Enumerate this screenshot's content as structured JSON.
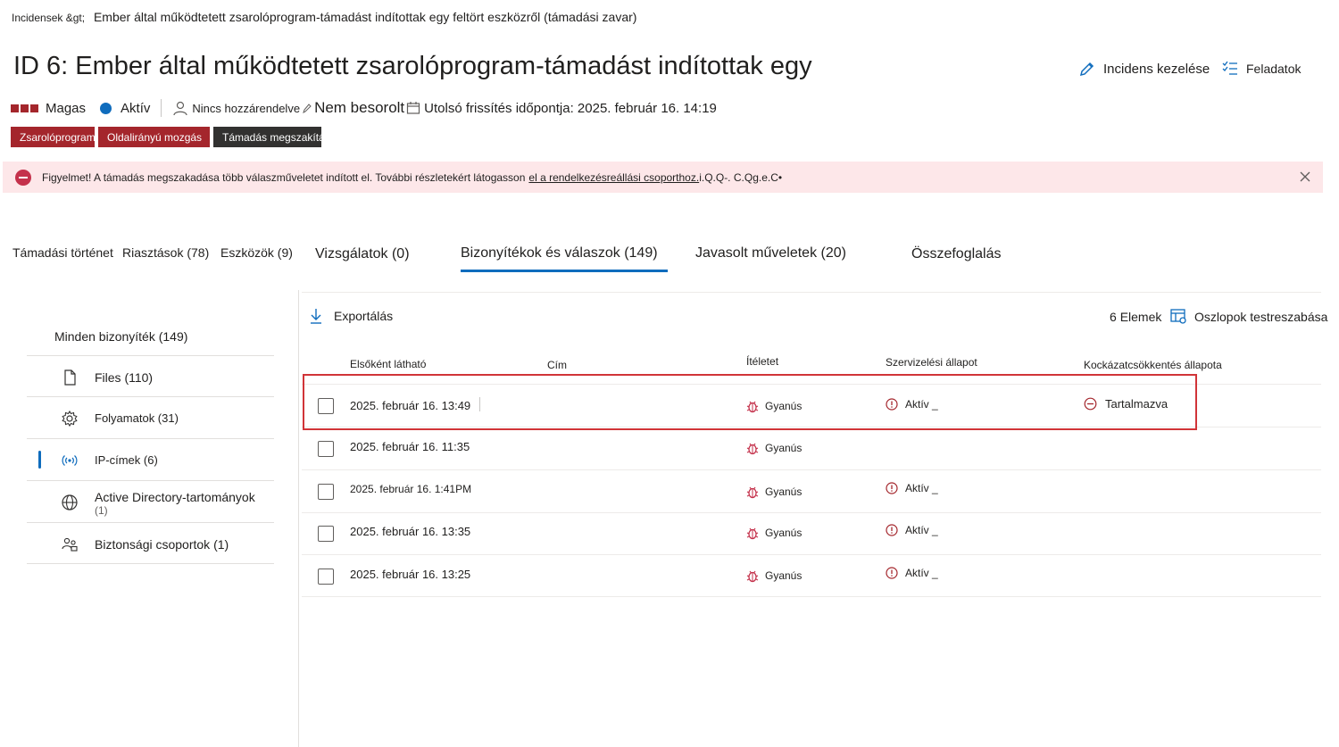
{
  "breadcrumb": {
    "link": "Incidensek &gt;",
    "current": "Ember által működtetett zsarolóprogram-támadást indítottak egy feltört eszközről (támadási zavar)"
  },
  "page_title": "ID 6: Ember által működtetett zsarolóprogram-támadást indítottak egy",
  "actions": {
    "manage_label": "Incidens kezelése",
    "tasks_label": "Feladatok"
  },
  "meta": {
    "severity": "Magas",
    "status": "Aktív",
    "assigned": "Nincs hozzárendelve",
    "classification": "Nem besorolt",
    "last_update": "Utolsó frissítés időpontja: 2025. február 16. 14:19"
  },
  "tags": [
    "Zsarolóprogram",
    "Oldalirányú mozgás",
    "Támadás megszakítás"
  ],
  "banner": {
    "text_before": "Figyelmet! A támadás megszakadása több válaszműveletet indított el. További részletekért látogasson",
    "link_text": "el a rendelkezésreállási csoporthoz.",
    "text_after": " i.Q.Q-. C.Qg.e.C•"
  },
  "tabs": [
    "Támadási történet",
    "Riasztások (78)",
    "Eszközök (9)",
    "Vizsgálatok (0)",
    "Bizonyítékok és válaszok (149)",
    "Javasolt műveletek (20)",
    "Összefoglalás"
  ],
  "left_panel": {
    "header": "Minden bizonyíték (149)",
    "items": [
      {
        "label": "Files (110)",
        "icon": "file-icon"
      },
      {
        "label": "Folyamatok (31)",
        "icon": "gear-icon"
      },
      {
        "label": "IP-címek (6)",
        "icon": "broadcast-icon"
      },
      {
        "label": "Active Directory-tartományok",
        "label2": "(1)",
        "icon": "globe-icon"
      },
      {
        "label": "Biztonsági csoportok (1)",
        "icon": "people-icon"
      }
    ]
  },
  "toolbar": {
    "export_label": "Exportálás",
    "items_count": "6",
    "items_label": "Elemek",
    "customize_label": "Oszlopok testreszabása"
  },
  "table": {
    "headers": [
      "Elsőként látható",
      "Cím",
      "Ítéletet",
      "Szervizelési állapot",
      "Kockázatcsökkentés állapota"
    ],
    "rows": [
      {
        "date": "2025. február 16. 13:49",
        "verdict": "Gyanús",
        "service": "Aktív _",
        "risk": "Tartalmazva"
      },
      {
        "date": "2025. február 16. 11:35",
        "verdict": "Gyanús",
        "service": "",
        "risk": ""
      },
      {
        "date": "2025. február 16. 1:41PM",
        "verdict": "Gyanús",
        "service": "Aktív _",
        "risk": ""
      },
      {
        "date": "2025. február 16. 13:35",
        "verdict": "Gyanús",
        "service": "Aktív _",
        "risk": ""
      },
      {
        "date": "2025. február 16. 13:25",
        "verdict": "Gyanús",
        "service": "Aktív _",
        "risk": ""
      }
    ]
  },
  "colors": {
    "accent": "#0f6cbd",
    "severity": "#a4262c",
    "banner_bg": "#fde7e9",
    "highlight": "#d13438",
    "suspicious": "#c4314b"
  }
}
